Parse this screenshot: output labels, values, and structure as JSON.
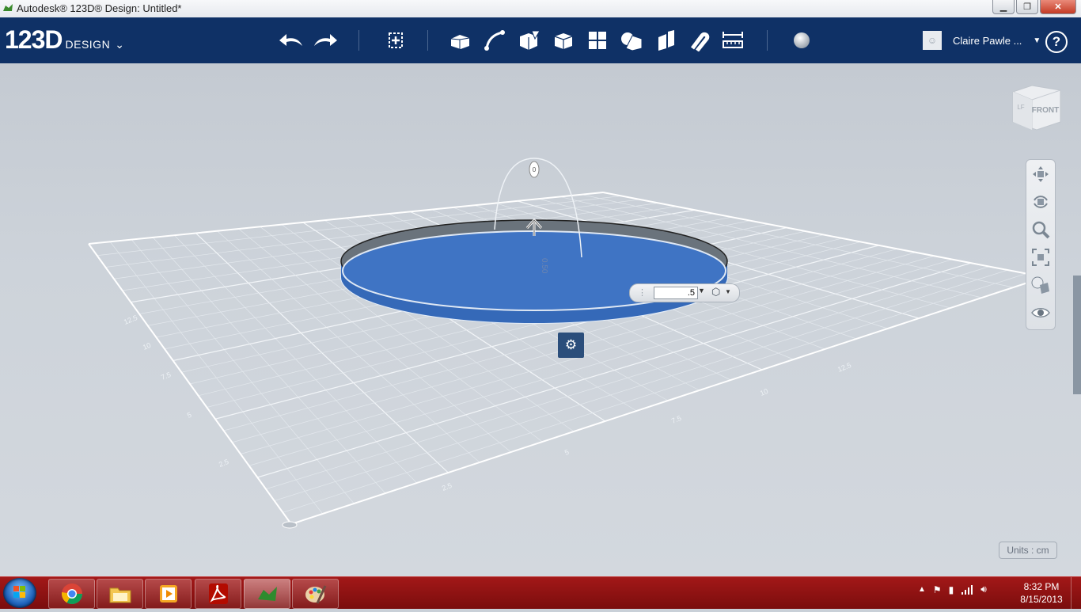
{
  "window": {
    "title": "Autodesk® 123D® Design: Untitled*",
    "buttons": [
      "minimize-icon",
      "maximize-icon",
      "close-icon"
    ]
  },
  "brand": {
    "logo": "123D",
    "product": "DESIGN"
  },
  "toolbar": {
    "tools": [
      "undo-icon",
      "redo-icon",
      "transform-icon",
      "primitives-icon",
      "sketch-icon",
      "construct-icon",
      "modify-icon",
      "pattern-icon",
      "grouping-icon",
      "combine-icon",
      "snap-icon",
      "measure-icon",
      "material-icon"
    ]
  },
  "user": {
    "name": "Claire Pawle ..."
  },
  "help_label": "?",
  "viewport": {
    "viewcube_front": "FRONT",
    "viewcube_left": "LF",
    "dimension_label": "0.50",
    "manipulator_label": "0",
    "extrude_value": ".5",
    "units_label": "Units : cm",
    "grid_labels": [
      "2.5",
      "5",
      "7.5",
      "10",
      "12.5",
      "2.5",
      "5",
      "7.5",
      "10",
      "12.5"
    ],
    "nav_tools": [
      "pan-icon",
      "orbit-icon",
      "zoom-icon",
      "fit-icon",
      "view-style-icon",
      "visibility-icon"
    ]
  },
  "taskbar": {
    "apps": [
      "chrome-icon",
      "explorer-icon",
      "media-player-icon",
      "acrobat-icon",
      "123d-icon",
      "paint-icon"
    ],
    "time": "8:32 PM",
    "date": "8/15/2013"
  },
  "colors": {
    "toolbar_bg": "#0f3166",
    "solid_blue": "#3f74c4",
    "taskbar_bg": "#8d1212"
  }
}
